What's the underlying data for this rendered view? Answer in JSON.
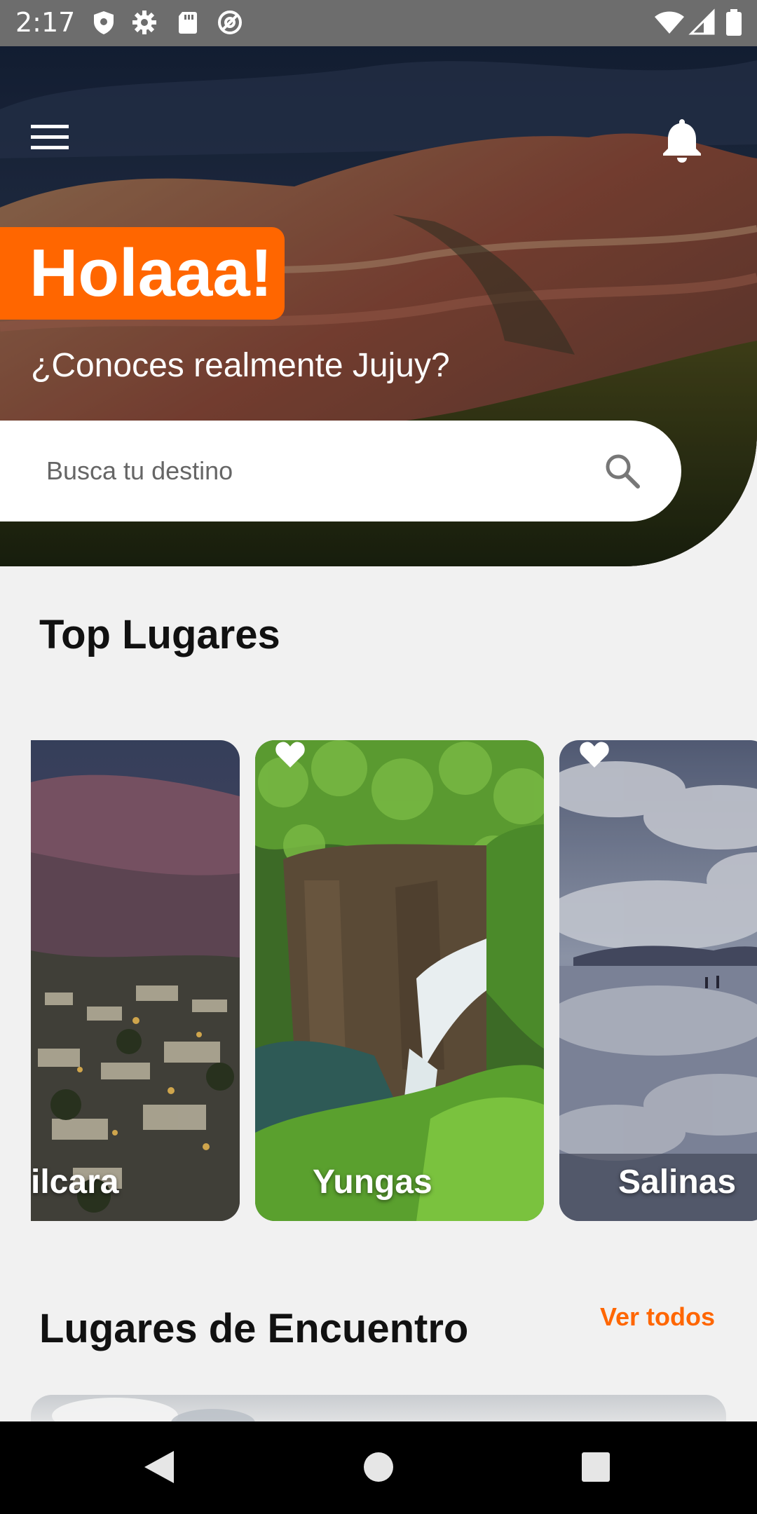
{
  "status_bar": {
    "time": "2:17"
  },
  "header": {
    "greeting": "Holaaa!",
    "subtitle": "¿Conoces realmente Jujuy?"
  },
  "search": {
    "placeholder": "Busca tu destino"
  },
  "top_places": {
    "title": "Top Lugares",
    "cards": [
      {
        "label": "ilcara"
      },
      {
        "label": "Yungas"
      },
      {
        "label": "Salinas"
      }
    ]
  },
  "meeting_places": {
    "title": "Lugares de Encuentro",
    "see_all": "Ver todos"
  },
  "colors": {
    "accent": "#ff6600",
    "status_bar": "#6d6d6d",
    "nav_bar": "#000000",
    "background": "#f1f1f1"
  },
  "icons": {
    "status": [
      "shield-icon",
      "gear-icon",
      "sd-card-icon",
      "at-sign-icon",
      "wifi-icon",
      "cell-signal-icon",
      "battery-icon"
    ],
    "header": [
      "menu-icon",
      "bell-icon"
    ],
    "search": "search-icon",
    "card": "heart-icon",
    "nav": [
      "back-icon",
      "home-icon",
      "recents-icon"
    ]
  }
}
